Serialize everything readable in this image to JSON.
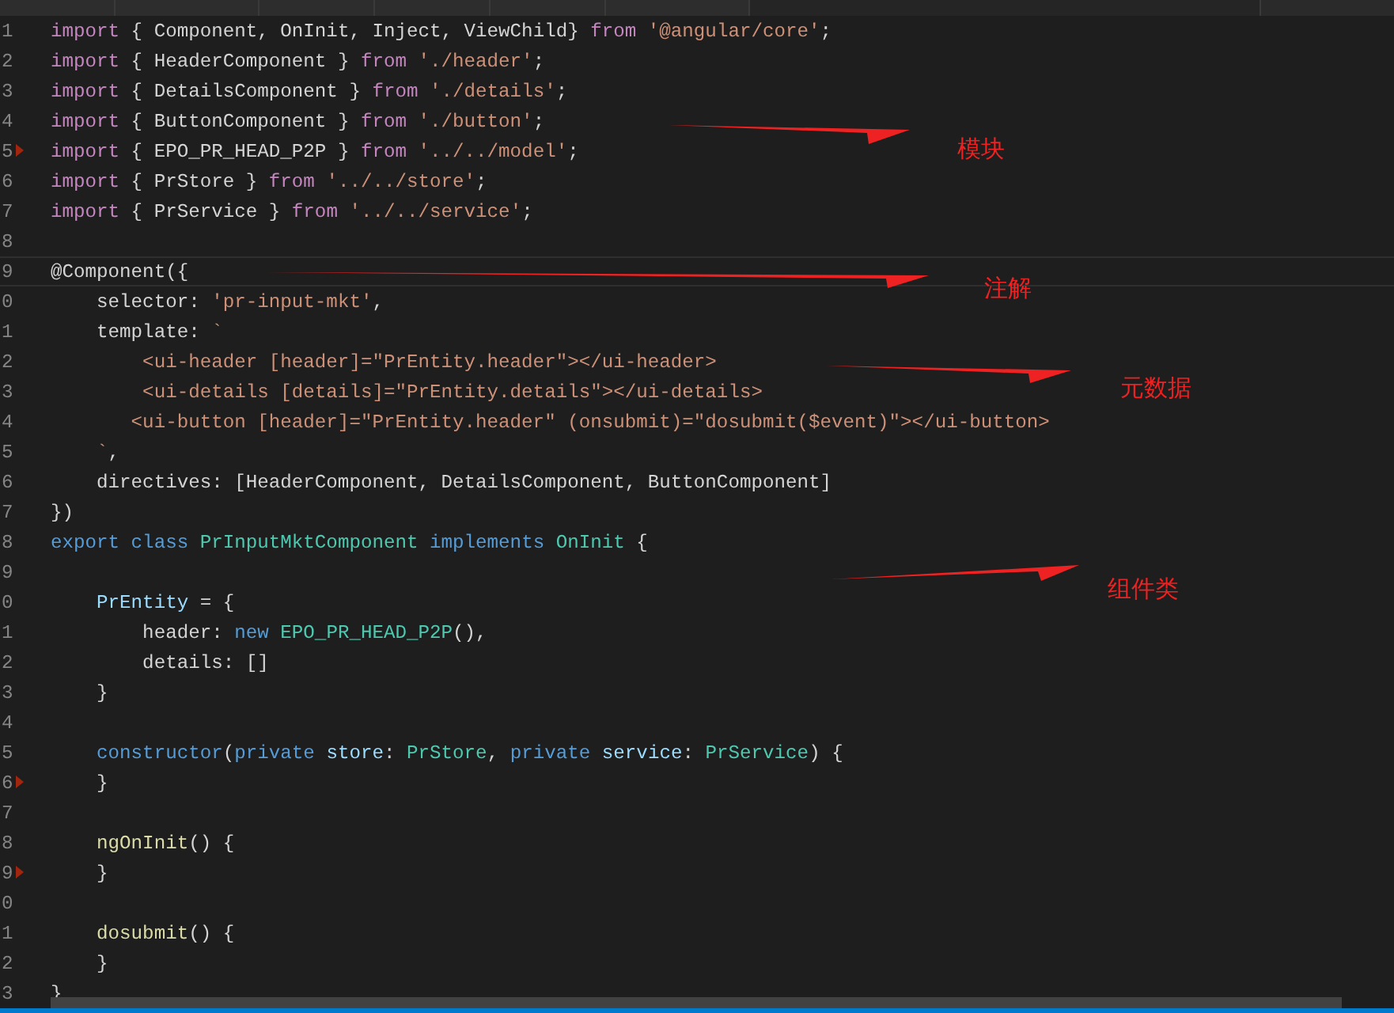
{
  "editor": {
    "lines": [
      {
        "number": "1",
        "tokens": [
          {
            "text": "import",
            "kind": "kw"
          },
          {
            "text": " { Component, OnInit, Inject, ViewChild} ",
            "kind": "p"
          },
          {
            "text": "from",
            "kind": "kw"
          },
          {
            "text": " '@angular/core'",
            "kind": "str"
          },
          {
            "text": ";",
            "kind": "p"
          }
        ]
      },
      {
        "number": "2",
        "tokens": [
          {
            "text": "import",
            "kind": "kw"
          },
          {
            "text": " { HeaderComponent } ",
            "kind": "p"
          },
          {
            "text": "from",
            "kind": "kw"
          },
          {
            "text": " './header'",
            "kind": "str"
          },
          {
            "text": ";",
            "kind": "p"
          }
        ]
      },
      {
        "number": "3",
        "tokens": [
          {
            "text": "import",
            "kind": "kw"
          },
          {
            "text": " { DetailsComponent } ",
            "kind": "p"
          },
          {
            "text": "from",
            "kind": "kw"
          },
          {
            "text": " './details'",
            "kind": "str"
          },
          {
            "text": ";",
            "kind": "p"
          }
        ]
      },
      {
        "number": "4",
        "tokens": [
          {
            "text": "import",
            "kind": "kw"
          },
          {
            "text": " { ButtonComponent } ",
            "kind": "p"
          },
          {
            "text": "from",
            "kind": "kw"
          },
          {
            "text": " './button'",
            "kind": "str"
          },
          {
            "text": ";",
            "kind": "p"
          }
        ]
      },
      {
        "number": "5",
        "marker": true,
        "tokens": [
          {
            "text": "import",
            "kind": "kw"
          },
          {
            "text": " { EPO_PR_HEAD_P2P } ",
            "kind": "p"
          },
          {
            "text": "from",
            "kind": "kw"
          },
          {
            "text": " '../../model'",
            "kind": "str"
          },
          {
            "text": ";",
            "kind": "p"
          }
        ]
      },
      {
        "number": "6",
        "tokens": [
          {
            "text": "import",
            "kind": "kw"
          },
          {
            "text": " { PrStore } ",
            "kind": "p"
          },
          {
            "text": "from",
            "kind": "kw"
          },
          {
            "text": " '../../store'",
            "kind": "str"
          },
          {
            "text": ";",
            "kind": "p"
          }
        ]
      },
      {
        "number": "7",
        "tokens": [
          {
            "text": "import",
            "kind": "kw"
          },
          {
            "text": " { PrService } ",
            "kind": "p"
          },
          {
            "text": "from",
            "kind": "kw"
          },
          {
            "text": " '../../service'",
            "kind": "str"
          },
          {
            "text": ";",
            "kind": "p"
          }
        ]
      },
      {
        "number": "8"
      },
      {
        "number": "9",
        "current": true,
        "tokens": [
          {
            "text": "@Component({",
            "kind": "p"
          }
        ]
      },
      {
        "number": "0",
        "tokens": [
          {
            "text": "    selector: ",
            "kind": "p"
          },
          {
            "text": "'pr-input-mkt'",
            "kind": "str"
          },
          {
            "text": ",",
            "kind": "p"
          }
        ]
      },
      {
        "number": "1",
        "tokens": [
          {
            "text": "    template: ",
            "kind": "p"
          },
          {
            "text": "`",
            "kind": "str"
          }
        ]
      },
      {
        "number": "2",
        "tokens": [
          {
            "text": "        <ui-header [header]=\"PrEntity.header\"></ui-header>",
            "kind": "str"
          }
        ]
      },
      {
        "number": "3",
        "tokens": [
          {
            "text": "        <ui-details [details]=\"PrEntity.details\"></ui-details>",
            "kind": "str"
          }
        ]
      },
      {
        "number": "4",
        "tokens": [
          {
            "text": "       <ui-button [header]=\"PrEntity.header\" (onsubmit)=\"dosubmit($event)\"></ui-button>",
            "kind": "str"
          }
        ]
      },
      {
        "number": "5",
        "tokens": [
          {
            "text": "    `",
            "kind": "str"
          },
          {
            "text": ",",
            "kind": "p"
          }
        ]
      },
      {
        "number": "6",
        "tokens": [
          {
            "text": "    directives: [HeaderComponent, DetailsComponent, ButtonComponent]",
            "kind": "p"
          }
        ]
      },
      {
        "number": "7",
        "tokens": [
          {
            "text": "})",
            "kind": "p"
          }
        ]
      },
      {
        "number": "8",
        "tokens": [
          {
            "text": "export",
            "kind": "sto"
          },
          {
            "text": " class",
            "kind": "sto"
          },
          {
            "text": " PrInputMktComponent",
            "kind": "type"
          },
          {
            "text": " implements",
            "kind": "sto"
          },
          {
            "text": " OnInit",
            "kind": "type"
          },
          {
            "text": " {",
            "kind": "p"
          }
        ]
      },
      {
        "number": "9"
      },
      {
        "number": "0",
        "tokens": [
          {
            "text": "    PrEntity",
            "kind": "var"
          },
          {
            "text": " = {",
            "kind": "p"
          }
        ]
      },
      {
        "number": "1",
        "tokens": [
          {
            "text": "        header: ",
            "kind": "p"
          },
          {
            "text": "new",
            "kind": "sto"
          },
          {
            "text": " EPO_PR_HEAD_P2P",
            "kind": "type"
          },
          {
            "text": "(),",
            "kind": "p"
          }
        ]
      },
      {
        "number": "2",
        "tokens": [
          {
            "text": "        details: []",
            "kind": "p"
          }
        ]
      },
      {
        "number": "3",
        "tokens": [
          {
            "text": "    }",
            "kind": "p"
          }
        ]
      },
      {
        "number": "4"
      },
      {
        "number": "5",
        "tokens": [
          {
            "text": "    constructor",
            "kind": "sto"
          },
          {
            "text": "(",
            "kind": "p"
          },
          {
            "text": "private",
            "kind": "sto"
          },
          {
            "text": " store",
            "kind": "var"
          },
          {
            "text": ": ",
            "kind": "p"
          },
          {
            "text": "PrStore",
            "kind": "type"
          },
          {
            "text": ", ",
            "kind": "p"
          },
          {
            "text": "private",
            "kind": "sto"
          },
          {
            "text": " service",
            "kind": "var"
          },
          {
            "text": ": ",
            "kind": "p"
          },
          {
            "text": "PrService",
            "kind": "type"
          },
          {
            "text": ") {",
            "kind": "p"
          }
        ]
      },
      {
        "number": "6",
        "marker": true,
        "tokens": [
          {
            "text": "    }",
            "kind": "p"
          }
        ]
      },
      {
        "number": "7"
      },
      {
        "number": "8",
        "tokens": [
          {
            "text": "    ngOnInit",
            "kind": "fn"
          },
          {
            "text": "() {",
            "kind": "p"
          }
        ]
      },
      {
        "number": "9",
        "marker": true,
        "tokens": [
          {
            "text": "    }",
            "kind": "p"
          }
        ]
      },
      {
        "number": "0"
      },
      {
        "number": "1",
        "tokens": [
          {
            "text": "    dosubmit",
            "kind": "fn"
          },
          {
            "text": "() {",
            "kind": "p"
          }
        ]
      },
      {
        "number": "2",
        "tokens": [
          {
            "text": "    }",
            "kind": "p"
          }
        ]
      },
      {
        "number": "3",
        "tokens": [
          {
            "text": "}",
            "kind": "p"
          }
        ]
      }
    ]
  },
  "annotations": [
    {
      "label": "模块"
    },
    {
      "label": "注解"
    },
    {
      "label": "元数据"
    },
    {
      "label": "组件类"
    }
  ]
}
